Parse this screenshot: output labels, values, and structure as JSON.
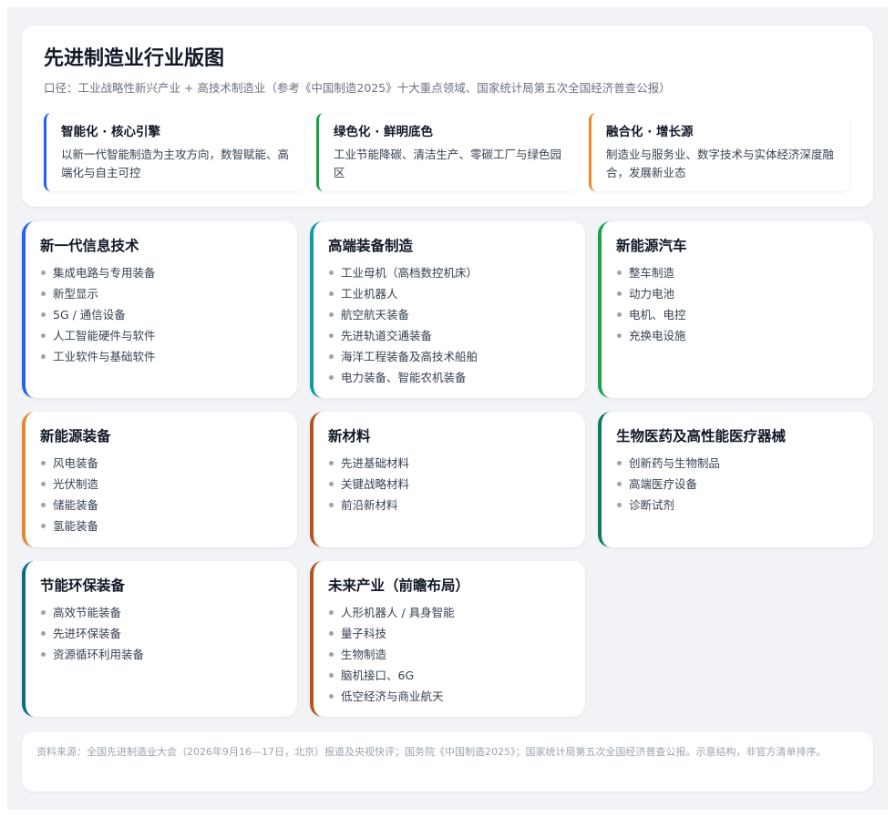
{
  "header": {
    "title": "先进制造业行业版图",
    "scope": "口径：工业战略性新兴产业 + 高技术制造业（参考《中国制造2025》十大重点领域、国家统计局第五次全国经济普查公报）"
  },
  "pillars": [
    {
      "title": "智能化 · 核心引擎",
      "desc": "以新一代智能制造为主攻方向，数智赋能、高端化与自主可控",
      "color": "#2563eb"
    },
    {
      "title": "绿色化 · 鲜明底色",
      "desc": "工业节能降碳、清洁生产、零碳工厂与绿色园区",
      "color": "#16a34a"
    },
    {
      "title": "融合化 · 增长源",
      "desc": "制造业与服务业、数字技术与实体经济深度融合，发展新业态",
      "color": "#ea8a2b"
    }
  ],
  "sectors": [
    {
      "title": "新一代信息技术",
      "color": "#2563eb",
      "items": [
        "集成电路与专用装备",
        "新型显示",
        "5G / 通信设备",
        "人工智能硬件与软件",
        "工业软件与基础软件"
      ]
    },
    {
      "title": "高端装备制造",
      "color": "#0e9aa7",
      "items": [
        "工业母机（高档数控机床）",
        "工业机器人",
        "航空航天装备",
        "先进轨道交通装备",
        "海洋工程装备及高技术船舶",
        "电力装备、智能农机装备"
      ]
    },
    {
      "title": "新能源汽车",
      "color": "#16a34a",
      "items": [
        "整车制造",
        "动力电池",
        "电机、电控",
        "充换电设施"
      ]
    },
    {
      "title": "新能源装备",
      "color": "#e08a2e",
      "items": [
        "风电装备",
        "光伏制造",
        "储能装备",
        "氢能装备"
      ]
    },
    {
      "title": "新材料",
      "color": "#b5561d",
      "items": [
        "先进基础材料",
        "关键战略材料",
        "前沿新材料"
      ]
    },
    {
      "title": "生物医药及高性能医疗器械",
      "color": "#0f7a63",
      "items": [
        "创新药与生物制品",
        "高端医疗设备",
        "诊断试剂"
      ]
    },
    {
      "title": "节能环保装备",
      "color": "#0e6a8a",
      "items": [
        "高效节能装备",
        "先进环保装备",
        "资源循环利用装备"
      ]
    },
    {
      "title": "未来产业（前瞻布局）",
      "color": "#b5561d",
      "items": [
        "人形机器人 / 具身智能",
        "量子科技",
        "生物制造",
        "脑机接口、6G",
        "低空经济与商业航天"
      ]
    }
  ],
  "footer": {
    "text": "资料来源：全国先进制造业大会（2026年9月16—17日，北京）报道及央视快评；国务院《中国制造2025》；国家统计局第五次全国经济普查公报。示意结构，非官方清单排序。"
  }
}
